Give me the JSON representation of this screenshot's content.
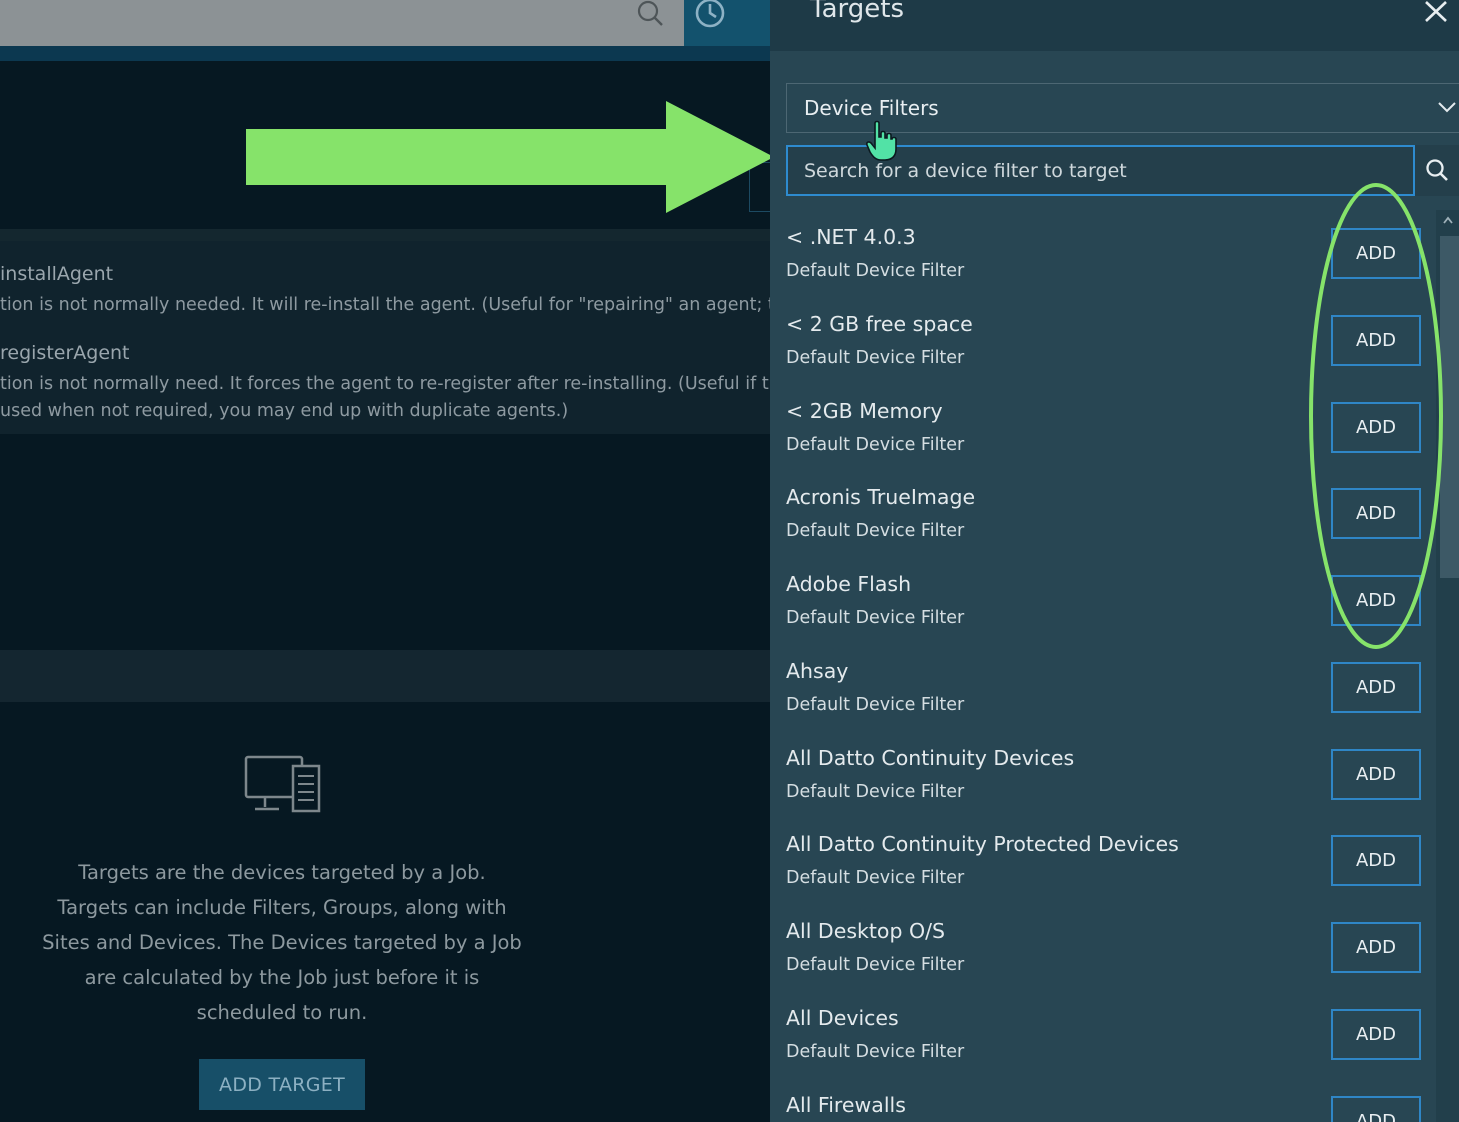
{
  "background_app": {
    "options": [
      {
        "title": "installAgent",
        "desc": [
          "tion is not normally needed. It will re-install the agent. (Useful for \"repairing\" an agent; this"
        ]
      },
      {
        "title": "registerAgent",
        "desc": [
          "tion is not normally need. It forces the agent to re-register after re-installing. (Useful if the",
          "used when not required, you may end up with duplicate agents.)"
        ]
      }
    ],
    "targets_empty_text": "Targets are the devices targeted by a Job. Targets can include Filters, Groups, along with Sites and Devices. The Devices targeted by a Job are calculated by the Job just before it is scheduled to run.",
    "add_target_label": "ADD TARGET"
  },
  "panel": {
    "title": "Targets",
    "filter_type": "Device Filters",
    "search_placeholder": "Search for a device filter to target",
    "add_label": "ADD",
    "items": [
      {
        "name": "< .NET 4.0.3",
        "type": "Default Device Filter"
      },
      {
        "name": "< 2 GB free space",
        "type": "Default Device Filter"
      },
      {
        "name": "< 2GB Memory",
        "type": "Default Device Filter"
      },
      {
        "name": "Acronis TrueImage",
        "type": "Default Device Filter"
      },
      {
        "name": "Adobe Flash",
        "type": "Default Device Filter"
      },
      {
        "name": "Ahsay",
        "type": "Default Device Filter"
      },
      {
        "name": "All Datto Continuity Devices",
        "type": "Default Device Filter"
      },
      {
        "name": "All Datto Continuity Protected Devices",
        "type": "Default Device Filter"
      },
      {
        "name": "All Desktop O/S",
        "type": "Default Device Filter"
      },
      {
        "name": "All Devices",
        "type": "Default Device Filter"
      },
      {
        "name": "All Firewalls",
        "type": ""
      }
    ]
  },
  "colors": {
    "accent_green": "#86e36a",
    "button_border": "#2f86c6",
    "panel_bg": "#284653"
  },
  "icons": [
    "search-icon",
    "clock-icon",
    "close-icon",
    "chevron-down-icon",
    "hand-cursor-icon",
    "device-icon",
    "scroll-up-icon"
  ]
}
